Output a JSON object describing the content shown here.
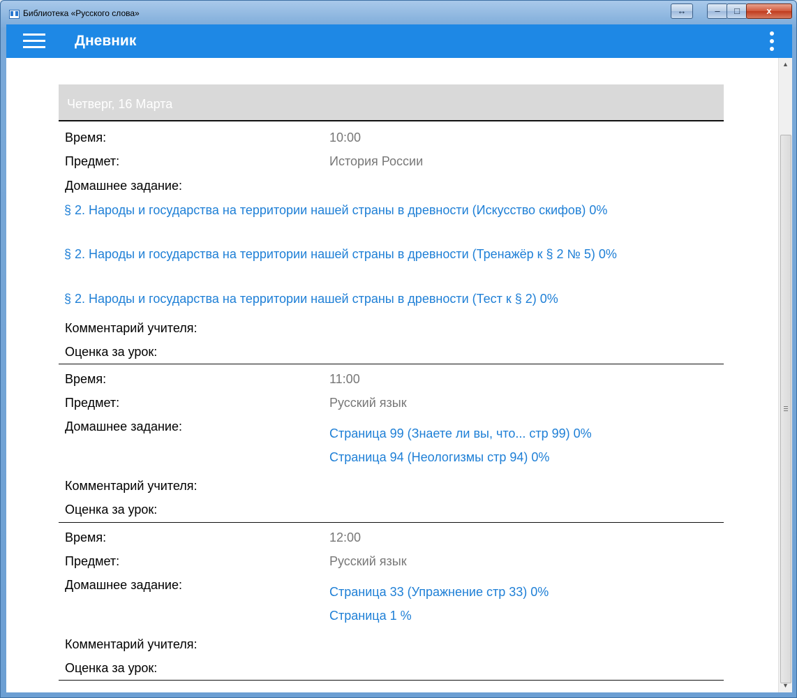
{
  "window": {
    "title": "Библиотека «Русского слова»",
    "resize_glyph": "↔",
    "minimize_glyph": "–",
    "maximize_glyph": "□",
    "close_glyph": "x"
  },
  "appbar": {
    "title": "Дневник",
    "menu_icon": "hamburger-icon",
    "more_icon": "kebab-icon"
  },
  "date_header": "Четверг, 16 Марта",
  "lessons": [
    {
      "time_label": "Время:",
      "time": "10:00",
      "subject_label": "Предмет:",
      "subject": "История России",
      "homework_label": "Домашнее задание:",
      "homework": [
        "§ 2. Народы и государства на территории нашей страны в древности (Искусство скифов) 0%",
        "§ 2. Народы и государства на территории нашей страны в древности (Тренажёр к § 2 № 5) 0%",
        "§ 2. Народы и государства на территории нашей страны в древности (Тест к § 2) 0%"
      ],
      "comment_label": "Комментарий учителя:",
      "grade_label": "Оценка за урок:"
    },
    {
      "time_label": "Время:",
      "time": "11:00",
      "subject_label": "Предмет:",
      "subject": "Русский язык",
      "homework_label": "Домашнее задание:",
      "homework": [
        "Страница 99 (Знаете ли вы, что... стр 99) 0%",
        "Страница 94 (Неологизмы стр 94) 0%"
      ],
      "comment_label": "Комментарий учителя:",
      "grade_label": "Оценка за урок:"
    },
    {
      "time_label": "Время:",
      "time": "12:00",
      "subject_label": "Предмет:",
      "subject": "Русский язык",
      "homework_label": "Домашнее задание:",
      "homework": [
        "Страница 33 (Упражнение стр 33) 0%",
        "Страница 1 %"
      ],
      "comment_label": "Комментарий учителя:",
      "grade_label": "Оценка за урок:"
    }
  ]
}
